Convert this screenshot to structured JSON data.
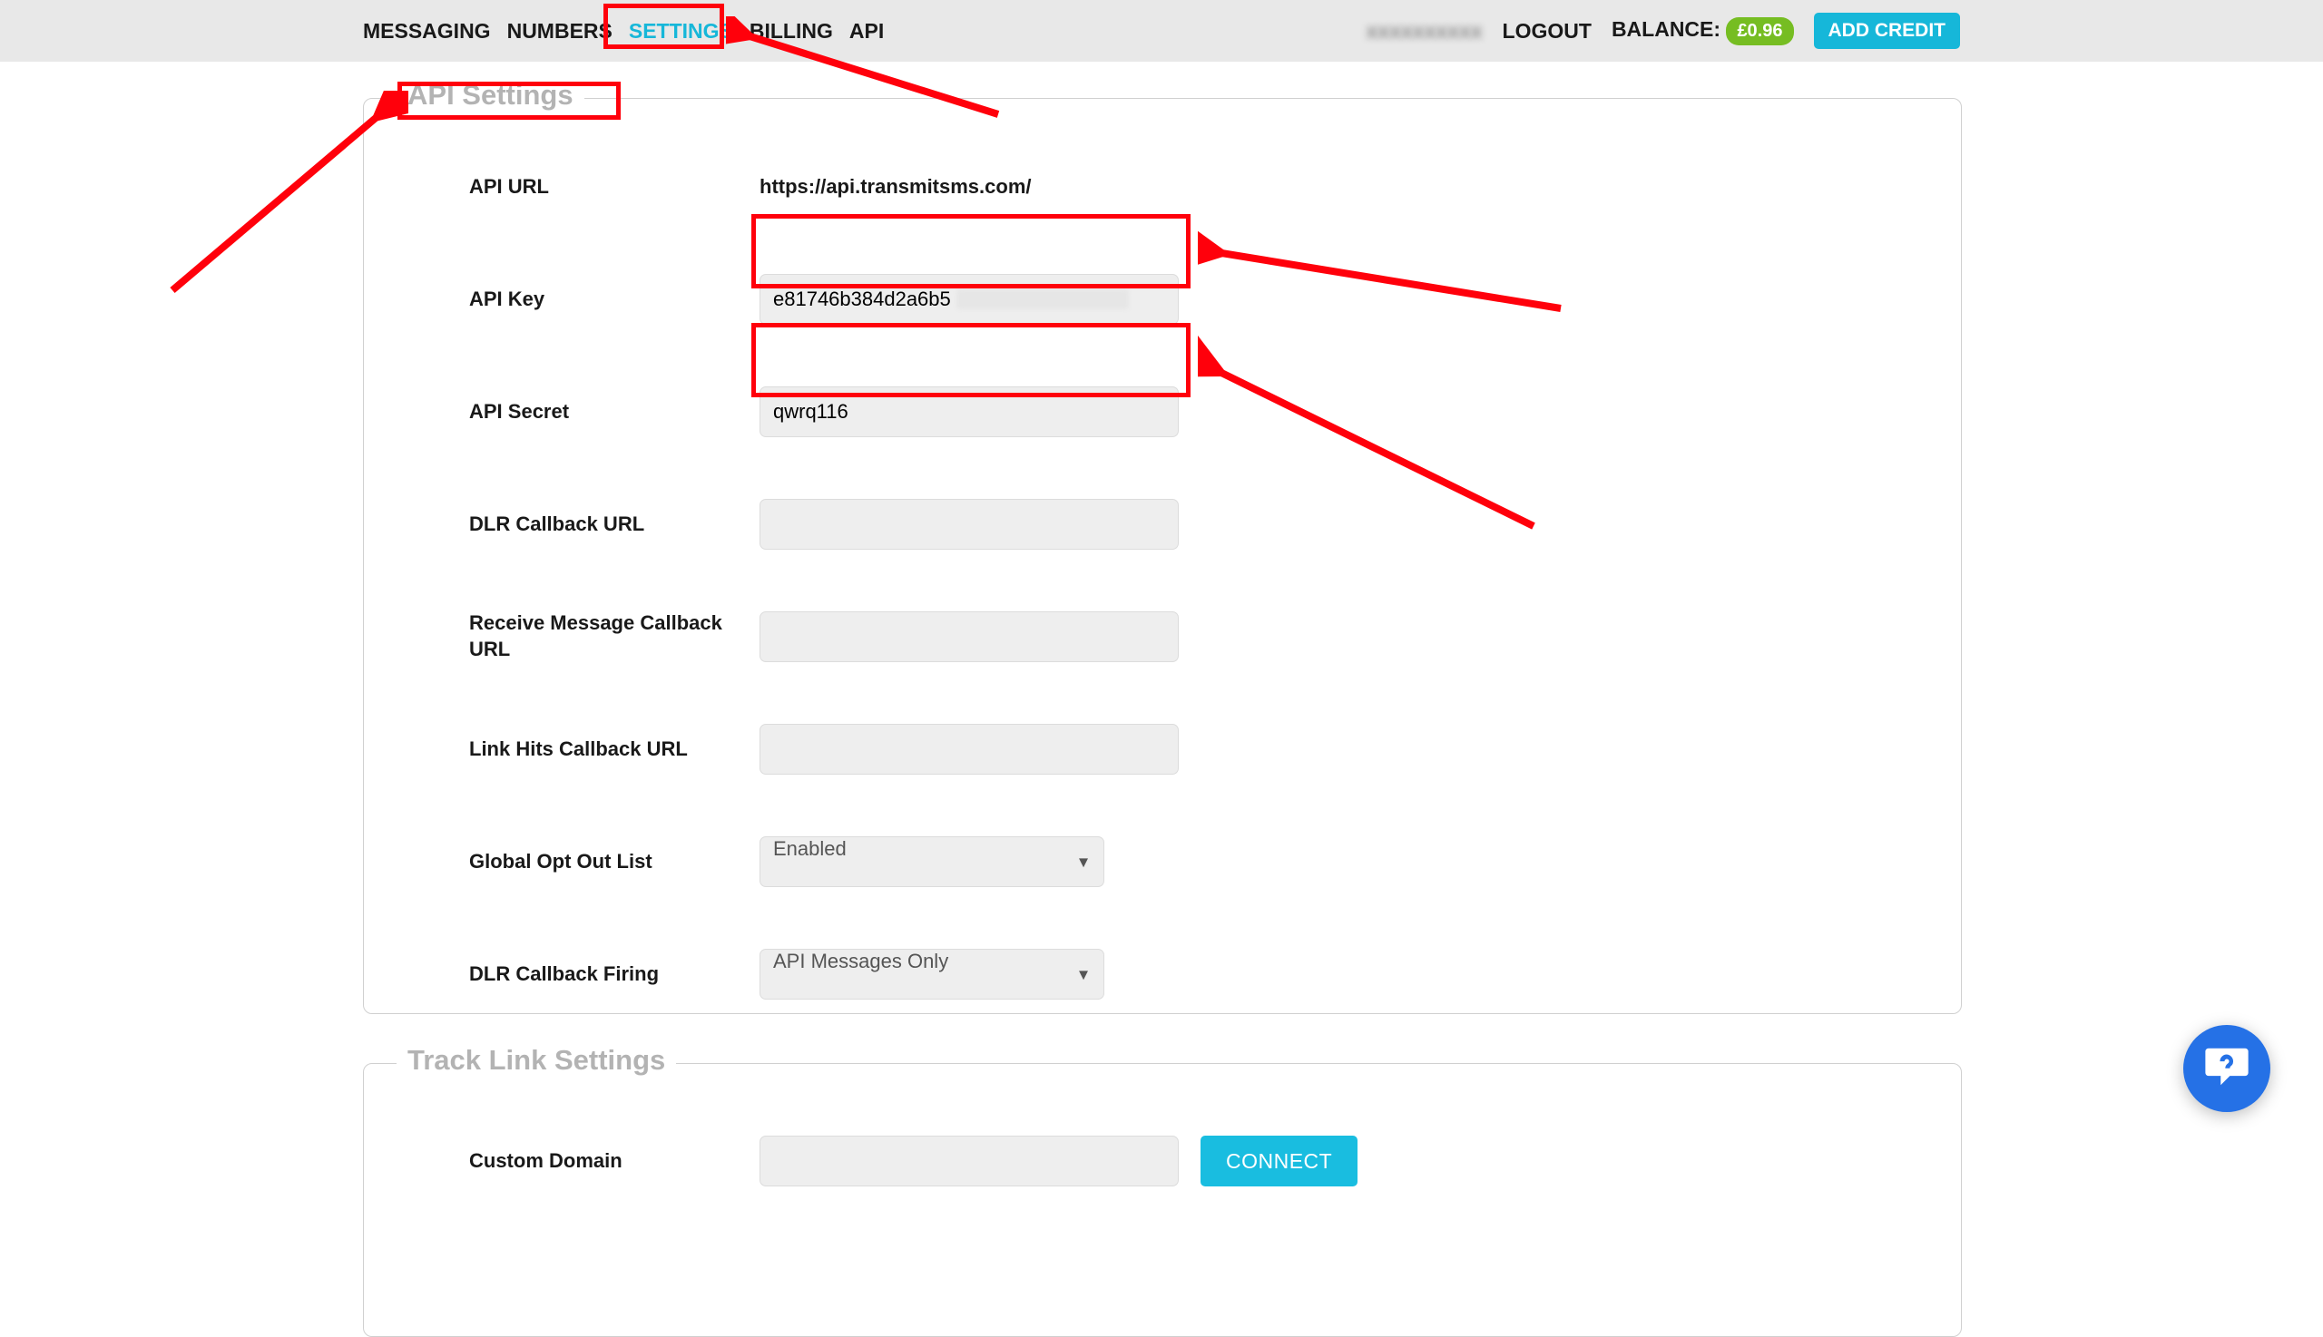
{
  "nav": {
    "items": [
      {
        "id": "messaging",
        "label": "MESSAGING",
        "active": false
      },
      {
        "id": "numbers",
        "label": "NUMBERS",
        "active": false
      },
      {
        "id": "settings",
        "label": "SETTINGS",
        "active": true
      },
      {
        "id": "billing",
        "label": "BILLING",
        "active": false
      },
      {
        "id": "api",
        "label": "API",
        "active": false
      }
    ],
    "logout": "LOGOUT",
    "balance_label": "BALANCE:",
    "balance_value": "£0.96",
    "add_credit": "ADD CREDIT"
  },
  "section_api": {
    "legend": "API Settings",
    "rows": {
      "api_url": {
        "label": "API URL",
        "value": "https://api.transmitsms.com/"
      },
      "api_key": {
        "label": "API Key",
        "value_visible": "e81746b384d2a6b5",
        "value_hidden": true
      },
      "api_secret": {
        "label": "API Secret",
        "value": "qwrq116"
      },
      "dlr_callback": {
        "label": "DLR Callback URL",
        "value": ""
      },
      "receive_callback": {
        "label": "Receive Message Callback URL",
        "value": ""
      },
      "linkhits_callback": {
        "label": "Link Hits Callback URL",
        "value": ""
      },
      "global_optout": {
        "label": "Global Opt Out List",
        "value": "Enabled"
      },
      "dlr_firing": {
        "label": "DLR Callback Firing",
        "value": "API Messages Only"
      }
    }
  },
  "section_track": {
    "legend": "Track Link Settings",
    "rows": {
      "custom_domain": {
        "label": "Custom Domain",
        "value": "",
        "connect": "CONNECT"
      }
    }
  },
  "annotations": {
    "highlight_color": "#ff000b",
    "boxes": [
      "nav-settings",
      "section-legend-api",
      "api-key-input",
      "api-secret-input"
    ],
    "arrows": [
      {
        "to": "nav-settings"
      },
      {
        "to": "section-legend-api"
      },
      {
        "to": "api-key-input"
      },
      {
        "to": "api-secret-input"
      }
    ]
  },
  "help_widget": {
    "icon": "chat-help-icon"
  }
}
